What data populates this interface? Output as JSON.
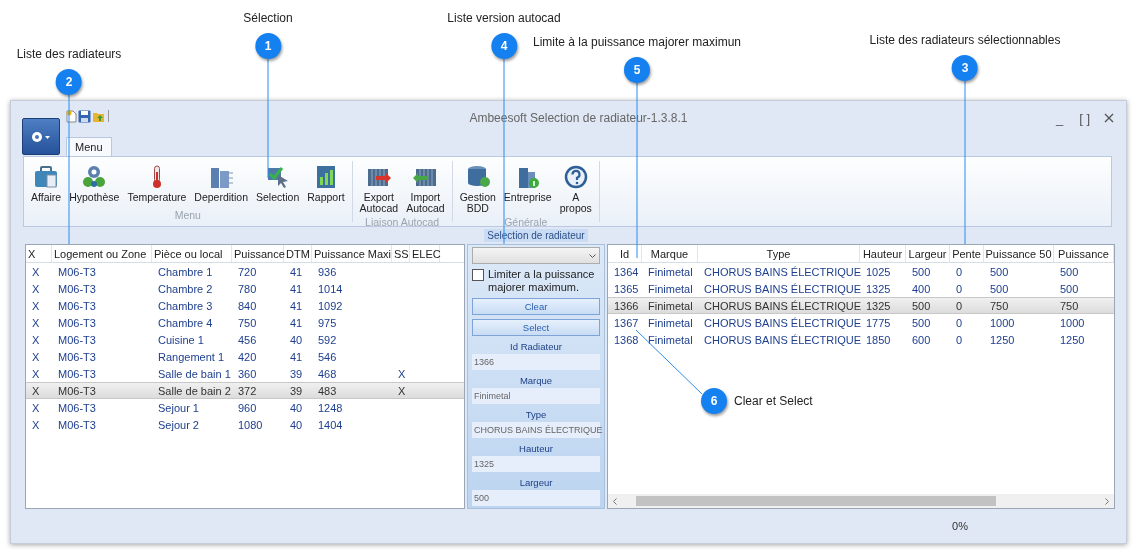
{
  "annotations": [
    {
      "number": "1",
      "label": "Sélection"
    },
    {
      "number": "2",
      "label": "Liste des radiateurs"
    },
    {
      "number": "3",
      "label": "Liste des radiateurs sélectionnables"
    },
    {
      "number": "4",
      "label": "Liste version autocad"
    },
    {
      "number": "5",
      "label": "Limite à la puissance majorer maximun"
    },
    {
      "number": "6",
      "label": "Clear et Select"
    }
  ],
  "window": {
    "title": "Ambeesoft Selection de radiateur-1.3.8.1",
    "minimize": "_",
    "maximize": "[ ]"
  },
  "tabs": [
    {
      "label": "Menu",
      "selected": true
    }
  ],
  "ribbon": {
    "groups": [
      {
        "label": "Menu",
        "buttons": [
          "Affaire",
          "Hypothèse",
          "Temperature",
          "Deperdition",
          "Selection",
          "Rapport"
        ]
      },
      {
        "label": "Liaison Autocad",
        "buttons": [
          "Export\nAutocad",
          "Import\nAutocad"
        ]
      },
      {
        "label": "Générale",
        "buttons": [
          "Gestion\nBDD",
          "Entreprise",
          "A\npropos"
        ]
      }
    ]
  },
  "radiator_list": {
    "columns": [
      "X",
      "Logement ou Zone",
      "Pièce ou local",
      "Puissance",
      "DTM",
      "Puissance Maxi",
      "SS",
      "ELEC"
    ],
    "rows": [
      {
        "x": "X",
        "logement": "M06-T3",
        "piece": "Chambre 1",
        "puissance": "720",
        "dtm": "41",
        "puissance_maxi": "936",
        "selected": false
      },
      {
        "x": "X",
        "logement": "M06-T3",
        "piece": "Chambre 2",
        "puissance": "780",
        "dtm": "41",
        "puissance_maxi": "1014",
        "selected": false
      },
      {
        "x": "X",
        "logement": "M06-T3",
        "piece": "Chambre 3",
        "puissance": "840",
        "dtm": "41",
        "puissance_maxi": "1092",
        "selected": false
      },
      {
        "x": "X",
        "logement": "M06-T3",
        "piece": "Chambre 4",
        "puissance": "750",
        "dtm": "41",
        "puissance_maxi": "975",
        "selected": false
      },
      {
        "x": "X",
        "logement": "M06-T3",
        "piece": "Cuisine 1",
        "puissance": "456",
        "dtm": "40",
        "puissance_maxi": "592",
        "selected": false
      },
      {
        "x": "X",
        "logement": "M06-T3",
        "piece": "Rangement 1",
        "puissance": "420",
        "dtm": "41",
        "puissance_maxi": "546",
        "selected": false
      },
      {
        "x": "X",
        "logement": "M06-T3",
        "piece": "Salle de bain 1",
        "puissance": "360",
        "dtm": "39",
        "puissance_maxi": "468",
        "ss": "X",
        "selected": false
      },
      {
        "x": "X",
        "logement": "M06-T3",
        "piece": "Salle de bain 2",
        "puissance": "372",
        "dtm": "39",
        "puissance_maxi": "483",
        "ss": "X",
        "selected": true
      },
      {
        "x": "X",
        "logement": "M06-T3",
        "piece": "Sejour 1",
        "puissance": "960",
        "dtm": "40",
        "puissance_maxi": "1248",
        "selected": false
      },
      {
        "x": "X",
        "logement": "M06-T3",
        "piece": "Sejour 2",
        "puissance": "1080",
        "dtm": "40",
        "puissance_maxi": "1404",
        "selected": false
      }
    ]
  },
  "selection_panel": {
    "title": "Selection de radiateur",
    "limit_checkbox": {
      "label": "Limiter a la puissance majorer maximum.",
      "checked": false
    },
    "buttons": [
      "Clear",
      "Select"
    ],
    "fields": [
      {
        "label": "Id Radiateur",
        "value": "1366"
      },
      {
        "label": "Marque",
        "value": "Finimetal"
      },
      {
        "label": "Type",
        "value": "CHORUS BAINS ÉLECTRIQUE"
      },
      {
        "label": "Hauteur",
        "value": "1325"
      },
      {
        "label": "Largeur",
        "value": "500"
      }
    ]
  },
  "selectable_radiators": {
    "columns": [
      "Id",
      "Marque",
      "Type",
      "Hauteur",
      "Largeur",
      "Pente",
      "Puissance 50",
      "Puissance"
    ],
    "rows": [
      {
        "id": "1364",
        "marque": "Finimetal",
        "type": "CHORUS BAINS ÉLECTRIQUE",
        "hauteur": "1025",
        "largeur": "500",
        "pente": "0",
        "puissance_50": "500",
        "puissance": "500",
        "selected": false
      },
      {
        "id": "1365",
        "marque": "Finimetal",
        "type": "CHORUS BAINS ÉLECTRIQUE",
        "hauteur": "1325",
        "largeur": "400",
        "pente": "0",
        "puissance_50": "500",
        "puissance": "500",
        "selected": false
      },
      {
        "id": "1366",
        "marque": "Finimetal",
        "type": "CHORUS BAINS ÉLECTRIQUE",
        "hauteur": "1325",
        "largeur": "500",
        "pente": "0",
        "puissance_50": "750",
        "puissance": "750",
        "selected": true
      },
      {
        "id": "1367",
        "marque": "Finimetal",
        "type": "CHORUS BAINS ÉLECTRIQUE",
        "hauteur": "1775",
        "largeur": "500",
        "pente": "0",
        "puissance_50": "1000",
        "puissance": "1000",
        "selected": false
      },
      {
        "id": "1368",
        "marque": "Finimetal",
        "type": "CHORUS BAINS ÉLECTRIQUE",
        "hauteur": "1850",
        "largeur": "600",
        "pente": "0",
        "puissance_50": "1250",
        "puissance": "1250",
        "selected": false
      }
    ]
  },
  "status_bar": {
    "progress": "0%"
  }
}
